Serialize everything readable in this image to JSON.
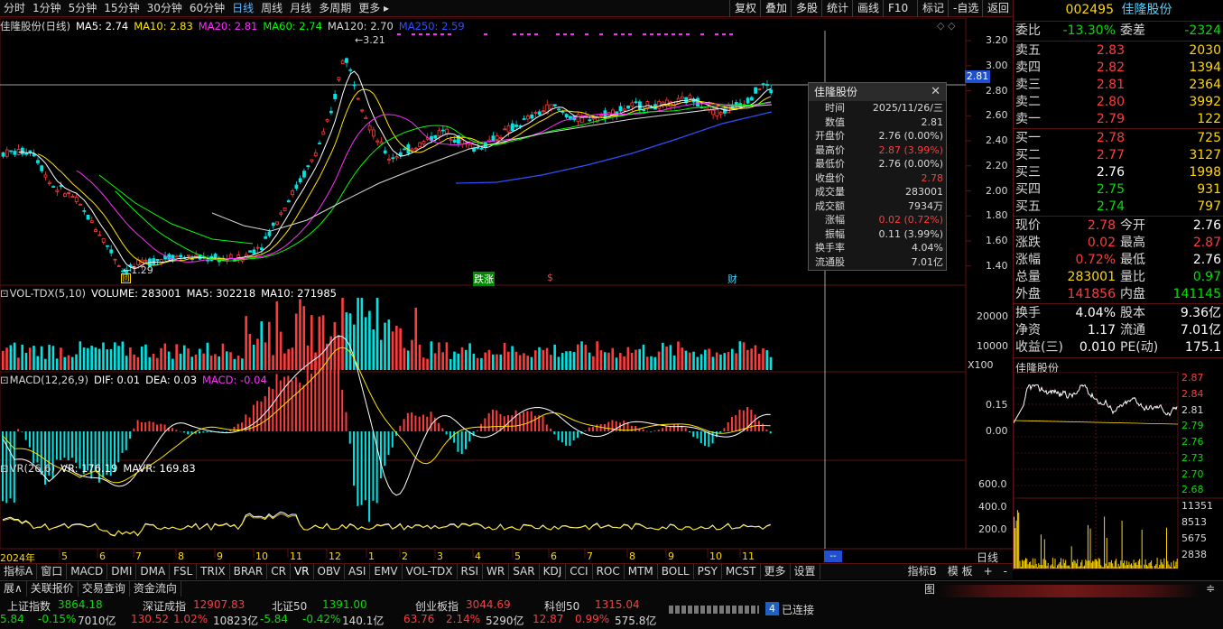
{
  "toolbar": {
    "periods": [
      "分时",
      "1分钟",
      "5分钟",
      "15分钟",
      "30分钟",
      "60分钟",
      "日线",
      "周线",
      "月线",
      "多周期",
      "更多 ▸"
    ],
    "active_period": "日线",
    "right_buttons": [
      "复权",
      "叠加",
      "多股",
      "统计",
      "画线",
      "F10",
      "标记",
      "-自选",
      "返回"
    ]
  },
  "main_chart": {
    "title": "佳隆股份(日线)",
    "ma": [
      {
        "label": "MA5: 2.74",
        "color": "#ffffff"
      },
      {
        "label": "MA10: 2.83",
        "color": "#ffe400"
      },
      {
        "label": "MA20: 2.81",
        "color": "#ff2cff"
      },
      {
        "label": "MA60: 2.74",
        "color": "#00ff00"
      },
      {
        "label": "MA120: 2.70",
        "color": "#d8d8d8"
      },
      {
        "label": "MA250: 2.59",
        "color": "#3050ff"
      }
    ],
    "y_ticks": [
      "3.20",
      "3.00",
      "2.80",
      "2.60",
      "2.40",
      "2.20",
      "2.00",
      "1.80",
      "1.60",
      "1.40"
    ],
    "y_range": [
      1.29,
      3.28
    ],
    "current_price_label": "2.81",
    "high_label": "3.21",
    "low_label": "1.29",
    "event_markers": [
      "跌涨",
      "$",
      "财"
    ]
  },
  "vol_panel": {
    "title": "VOL-TDX(5,10)",
    "values": [
      {
        "label": "VOLUME: 283001",
        "color": "#ffffff"
      },
      {
        "label": "MA5: 302218",
        "color": "#ffffff"
      },
      {
        "label": "MA10: 271985",
        "color": "#ffffff"
      }
    ],
    "y_ticks": [
      "20000",
      "10000"
    ],
    "unit": "X100"
  },
  "macd_panel": {
    "title": "MACD(12,26,9)",
    "values": [
      {
        "label": "DIF: 0.01",
        "color": "#ffffff"
      },
      {
        "label": "DEA: 0.03",
        "color": "#ffffff"
      },
      {
        "label": "MACD: -0.04",
        "color": "#ff2cff"
      }
    ],
    "y_ticks": [
      "0.15",
      "0.00"
    ]
  },
  "vr_panel": {
    "title": "VR(26,6)",
    "values": [
      {
        "label": "VR: 176.19",
        "color": "#ffffff"
      },
      {
        "label": "MAVR: 169.83",
        "color": "#ffffff"
      }
    ],
    "y_ticks": [
      "600.0",
      "400.0",
      "200.0"
    ]
  },
  "x_axis": {
    "labels": [
      "2024年",
      "5",
      "6",
      "7",
      "8",
      "9",
      "10",
      "11",
      "12",
      "1",
      "2",
      "3",
      "4",
      "5",
      "6",
      "7",
      "8",
      "9",
      "10",
      "11"
    ],
    "right_label": "日线",
    "cursor_label": "--"
  },
  "tooltip": {
    "title": "佳隆股份",
    "rows": [
      {
        "k": "时间",
        "v": "2025/11/26/三",
        "c": "#d8d8d8"
      },
      {
        "k": "数值",
        "v": "2.81",
        "c": "#d8d8d8"
      },
      {
        "k": "开盘价",
        "v": "2.76 (0.00%)",
        "c": "#d8d8d8"
      },
      {
        "k": "最高价",
        "v": "2.87 (3.99%)",
        "c": "#ff3c3c"
      },
      {
        "k": "最低价",
        "v": "2.76 (0.00%)",
        "c": "#d8d8d8"
      },
      {
        "k": "收盘价",
        "v": "2.78",
        "c": "#ff3c3c"
      },
      {
        "k": "成交量",
        "v": "283001",
        "c": "#d8d8d8"
      },
      {
        "k": "成交额",
        "v": "7934万",
        "c": "#d8d8d8"
      },
      {
        "k": "涨幅",
        "v": "0.02 (0.72%)",
        "c": "#ff3c3c"
      },
      {
        "k": "振幅",
        "v": "0.11 (3.99%)",
        "c": "#d8d8d8"
      },
      {
        "k": "换手率",
        "v": "4.04%",
        "c": "#d8d8d8"
      },
      {
        "k": "流通股",
        "v": "7.01亿",
        "c": "#d8d8d8"
      }
    ]
  },
  "quote": {
    "code": "002495",
    "name": "佳隆股份",
    "wei_bi": {
      "label": "委比",
      "value": "-13.30%",
      "label2": "委差",
      "value2": "-2324"
    },
    "sell": [
      {
        "label": "卖五",
        "price": "2.83",
        "vol": "2030"
      },
      {
        "label": "卖四",
        "price": "2.82",
        "vol": "1394"
      },
      {
        "label": "卖三",
        "price": "2.81",
        "vol": "2364"
      },
      {
        "label": "卖二",
        "price": "2.80",
        "vol": "3992"
      },
      {
        "label": "卖一",
        "price": "2.79",
        "vol": "122"
      }
    ],
    "buy": [
      {
        "label": "买一",
        "price": "2.78",
        "vol": "725",
        "pc": "#ff3c3c"
      },
      {
        "label": "买二",
        "price": "2.77",
        "vol": "3127",
        "pc": "#ff3c3c"
      },
      {
        "label": "买三",
        "price": "2.76",
        "vol": "1998",
        "pc": "#ffffff"
      },
      {
        "label": "买四",
        "price": "2.75",
        "vol": "931",
        "pc": "#00e000"
      },
      {
        "label": "买五",
        "price": "2.74",
        "vol": "797",
        "pc": "#00e000"
      }
    ],
    "stats": [
      {
        "l1": "现价",
        "v1": "2.78",
        "c1": "#ff3c3c",
        "l2": "今开",
        "v2": "2.76",
        "c2": "#ffffff"
      },
      {
        "l1": "涨跌",
        "v1": "0.02",
        "c1": "#ff3c3c",
        "l2": "最高",
        "v2": "2.87",
        "c2": "#ff3c3c"
      },
      {
        "l1": "涨幅",
        "v1": "0.72%",
        "c1": "#ff3c3c",
        "l2": "最低",
        "v2": "2.76",
        "c2": "#ffffff"
      },
      {
        "l1": "总量",
        "v1": "283001",
        "c1": "#ffd800",
        "l2": "量比",
        "v2": "0.97",
        "c2": "#00e000"
      },
      {
        "l1": "外盘",
        "v1": "141856",
        "c1": "#ff3c3c",
        "l2": "内盘",
        "v2": "141145",
        "c2": "#00e000"
      }
    ],
    "stats2": [
      {
        "l1": "换手",
        "v1": "4.04%",
        "c1": "#ffffff",
        "l2": "股本",
        "v2": "9.36亿",
        "c2": "#ffffff"
      },
      {
        "l1": "净资",
        "v1": "1.17",
        "c1": "#ffffff",
        "l2": "流通",
        "v2": "7.01亿",
        "c2": "#ffffff"
      },
      {
        "l1": "收益(三)",
        "v1": "0.010",
        "c1": "#ffffff",
        "l2": "PE(动)",
        "v2": "175.1",
        "c2": "#ffffff"
      }
    ]
  },
  "mini_chart": {
    "title": "佳隆股份",
    "price_ticks": [
      "2.87",
      "2.84",
      "2.81",
      "2.79",
      "2.76",
      "2.73",
      "2.70",
      "2.68"
    ],
    "vol_ticks": [
      "11351",
      "8513",
      "5675",
      "2838"
    ]
  },
  "indicator_tabs": [
    "指标A",
    "窗口",
    "MACD",
    "DMI",
    "DMA",
    "FSL",
    "TRIX",
    "BRAR",
    "CR",
    "VR",
    "OBV",
    "ASI",
    "EMV",
    "VOL-TDX",
    "RSI",
    "WR",
    "SAR",
    "KDJ",
    "CCI",
    "ROC",
    "MTM",
    "BOLL",
    "PSY",
    "MCST",
    "更多",
    "设置"
  ],
  "indicator_active": "VR",
  "indicator_right": [
    "指标B",
    "模 板",
    "+",
    "-"
  ],
  "bottom_menu": [
    "展∧",
    "关联报价",
    "交易查询",
    "资金流向"
  ],
  "bottom_menu_right": "图",
  "indices": [
    {
      "name": "上证指数",
      "value": "3864.18",
      "chg": "5.84",
      "pct": "-0.15%",
      "amt": "7010亿",
      "vcolor": "#00e000",
      "ccolor": "#00e000"
    },
    {
      "name": "深证成指",
      "value": "12907.83",
      "chg": "130.52",
      "pct": "1.02%",
      "amt": "10823亿",
      "vcolor": "#ff3c3c",
      "ccolor": "#ff3c3c"
    },
    {
      "name": "北证50",
      "value": "1391.00",
      "chg": "-5.84",
      "pct": "-0.42%",
      "amt": "140.1亿",
      "vcolor": "#00e000",
      "ccolor": "#00e000"
    },
    {
      "name": "创业板指",
      "value": "3044.69",
      "chg": "63.76",
      "pct": "2.14%",
      "amt": "5290亿",
      "vcolor": "#ff3c3c",
      "ccolor": "#ff3c3c"
    },
    {
      "name": "科创50",
      "value": "1315.04",
      "chg": "12.87",
      "pct": "0.99%",
      "amt": "575.8亿",
      "vcolor": "#ff3c3c",
      "ccolor": "#ff3c3c"
    }
  ],
  "connection": {
    "badge": "4",
    "label": "已连接"
  },
  "colors": {
    "up": "#ff3c3c",
    "down": "#00e000",
    "ma5": "#ffffff",
    "ma10": "#ffe400",
    "ma20": "#ff2cff",
    "ma60": "#00ff00",
    "ma250": "#3050ff",
    "frame": "#5a1212"
  }
}
